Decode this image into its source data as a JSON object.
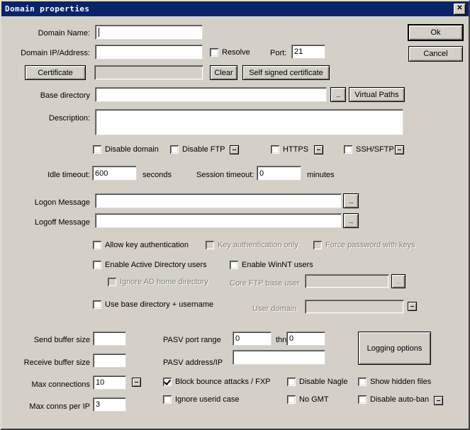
{
  "window": {
    "title": "Domain properties",
    "close_label": "✕"
  },
  "buttons": {
    "ok": "Ok",
    "cancel": "Cancel",
    "certificate": "Certificate",
    "clear": "Clear",
    "self_signed": "Self signed certificate",
    "base_dir_browse": "...",
    "virtual_paths": "Virtual Paths",
    "logon_browse": "...",
    "logoff_browse": "...",
    "core_ftp_browse": "...",
    "logging_options": "Logging options"
  },
  "labels": {
    "domain_name": "Domain Name:",
    "domain_ip": "Domain IP/Address:",
    "port": "Port:",
    "base_directory": "Base directory",
    "description": "Description:",
    "idle_timeout": "Idle timeout:",
    "seconds": "seconds",
    "session_timeout": "Session timeout:",
    "minutes": "minutes",
    "logon_message": "Logon Message",
    "logoff_message": "Logoff Message",
    "core_ftp_base_user": "Core FTP base user",
    "user_domain": "User domain",
    "send_buffer_size": "Send buffer size",
    "receive_buffer_size": "Receive buffer size",
    "max_connections": "Max connections",
    "max_conns_per_ip": "Max conns per IP",
    "pasv_port_range": "PASV port range",
    "thru": "thru",
    "pasv_address_ip": "PASV address/IP"
  },
  "fields": {
    "domain_name": "",
    "domain_ip": "",
    "port": "21",
    "certificate_path": "",
    "base_directory": "",
    "description": "",
    "idle_timeout": "600",
    "session_timeout": "0",
    "logon_message": "",
    "logoff_message": "",
    "core_ftp_base_user": "",
    "user_domain": "",
    "send_buffer_size": "",
    "receive_buffer_size": "",
    "max_connections": "10",
    "max_conns_per_ip": "3",
    "pasv_port_start": "0",
    "pasv_port_end": "0",
    "pasv_address_ip": ""
  },
  "checkboxes": {
    "resolve": "Resolve",
    "disable_domain": "Disable domain",
    "disable_ftp": "Disable FTP",
    "https": "HTTPS",
    "ssh_sftp": "SSH/SFTP",
    "allow_key_auth": "Allow key authentication",
    "key_auth_only": "Key authentication only",
    "force_password_with_keys": "Force password with keys",
    "enable_ad_users": "Enable Active Directory users",
    "enable_winnt_users": "Enable WinNT users",
    "ignore_ad_home_directory": "Ignore AD home directory",
    "use_base_dir_username": "Use base directory + username",
    "block_bounce": "Block bounce attacks / FXP",
    "ignore_userid_case": "Ignore userid case",
    "disable_nagle": "Disable Nagle",
    "no_gmt": "No GMT",
    "show_hidden_files": "Show hidden files",
    "disable_auto_ban": "Disable auto-ban"
  },
  "colors": {
    "titlebar": "#0a246a",
    "dialog_face": "#d4d0c8",
    "field_bg": "#ffffff",
    "disabled_text": "#808080"
  }
}
